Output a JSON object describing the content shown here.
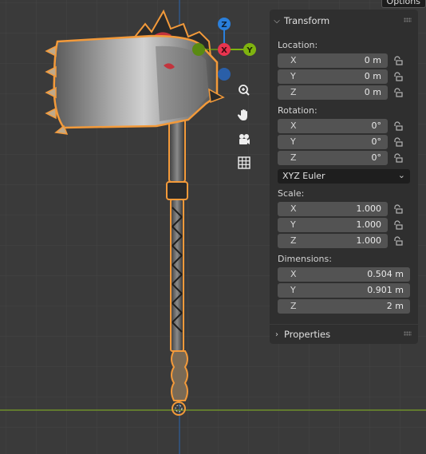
{
  "options_label": "Options",
  "transform": {
    "title": "Transform",
    "location_label": "Location:",
    "location": [
      {
        "axis": "X",
        "value": "0 m"
      },
      {
        "axis": "Y",
        "value": "0 m"
      },
      {
        "axis": "Z",
        "value": "0 m"
      }
    ],
    "rotation_label": "Rotation:",
    "rotation": [
      {
        "axis": "X",
        "value": "0°"
      },
      {
        "axis": "Y",
        "value": "0°"
      },
      {
        "axis": "Z",
        "value": "0°"
      }
    ],
    "rotation_mode": "XYZ Euler",
    "scale_label": "Scale:",
    "scale": [
      {
        "axis": "X",
        "value": "1.000"
      },
      {
        "axis": "Y",
        "value": "1.000"
      },
      {
        "axis": "Z",
        "value": "1.000"
      }
    ],
    "dimensions_label": "Dimensions:",
    "dimensions": [
      {
        "axis": "X",
        "value": "0.504 m"
      },
      {
        "axis": "Y",
        "value": "0.901 m"
      },
      {
        "axis": "Z",
        "value": "2 m"
      }
    ]
  },
  "properties": {
    "title": "Properties"
  },
  "gizmo": {
    "x_label": "X",
    "y_label": "Y",
    "z_label": "Z"
  },
  "colors": {
    "x_axis": "#e8344f",
    "y_axis": "#7fb30f",
    "z_axis": "#2a7fdb",
    "selection_outline": "#f39a3a",
    "grid_bg": "#3a3a3a",
    "panel_bg": "#2f2f2f"
  },
  "nav_icons": [
    "zoom-icon",
    "hand-pan-icon",
    "camera-icon",
    "grid-ortho-icon"
  ]
}
